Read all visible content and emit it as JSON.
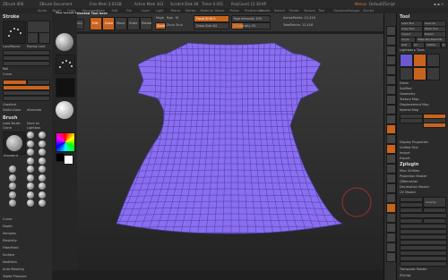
{
  "titlebar": {
    "app": "ZBrush 4R6",
    "doc": "ZBrush Document",
    "free_mem": "Free Mem 3.01GB",
    "active_mem": "Active Mem 342",
    "scratch": "Scratch Disk 48",
    "timer": "Timer 0.001",
    "poly_count": "PolyCount 12.39 KP",
    "menus": "Menus",
    "default_script": "DefaultZScript"
  },
  "menubar": {
    "items": [
      "Alpha",
      "Brush",
      "Color",
      "Document",
      "Draw",
      "Edit",
      "File",
      "Layer",
      "Light",
      "Macro",
      "Marker",
      "Material",
      "Movie",
      "Picker",
      "Preferences",
      "Render",
      "Stencil",
      "Stroke",
      "Texture",
      "Tool",
      "Transform",
      "Zplugin",
      "Zscript"
    ]
  },
  "topbar": {
    "hint": "The Insert Selected Tool here",
    "projection_master": "Projection Master",
    "lightbox": "LightBox",
    "edit": "Edit",
    "draw": "Draw",
    "move": "Move",
    "scale": "Scale",
    "rotate": "Rotate",
    "mrgb": "Mrgb",
    "rgb": "Rgb",
    "m": "M",
    "zadd": "Zadd",
    "zsub": "Zsub",
    "zcut": "Zcut",
    "focal_shift": "Focal Shift 0",
    "draw_size": "Draw Size 64",
    "rgb_intensity": "Rgb Intensity 100",
    "z_intensity": "Z Intensity 25",
    "active_points": "ActivePoints: 12,416",
    "total_points": "TotalPoints: 12,416"
  },
  "left": {
    "title": "Stroke",
    "lazy_mouse": "LazyMouse",
    "replay_last": "Replay Last",
    "roll": "Roll",
    "curve": "Curve",
    "brush_section": "Brush",
    "load_brush": "Load Brush",
    "save_as": "Save As",
    "clone": "Clone",
    "lightbox_brushes": "Lightbox",
    "standard": "Standard",
    "groups": [
      "Curve",
      "Depth",
      "Samples",
      "Elasticity",
      "FiberMesh",
      "Surface",
      "Modifiers",
      "Auto Masking",
      "Tablet Pressure",
      "Alpha and Texture",
      "Clip Brush Modifiers",
      "Smooth Brush Modifiers",
      "Edit Brush Credit",
      "Reset All Brushes"
    ],
    "gradient": "Gradient",
    "switch_color": "SwitchColor",
    "alternate": "Alternate"
  },
  "right": {
    "title": "Tool",
    "load_tool": "Load Tool",
    "save_as": "Save As",
    "copy_tool": "Copy Tool",
    "paste_tool": "Paste Tool",
    "import": "Import",
    "export": "Export",
    "clone": "Clone",
    "make_polymesh": "Make PolyMesh3D",
    "goz": "GoZ",
    "all": "All",
    "visible": "Visible",
    "r": "R",
    "lightbox_tools": "Lightbox ▸ Tools",
    "current_tool": "Dress",
    "subtool": "SubTool",
    "geometry": "Geometry",
    "texture_map": "Texture Map",
    "displacement_map": "Displacement Map",
    "normal_map": "Normal Map",
    "display_properties": "Display Properties",
    "unified_skin": "Unified Skin",
    "import_section": "Import",
    "export_section": "Export",
    "zplugin": "Zplugin",
    "misc_utilities": "Misc Utilities",
    "projection_master": "Projection Master",
    "qremesher": "QRemesher",
    "decimation": "Decimation Master",
    "uv_master": "UV Master",
    "unwrap": "Unwrap",
    "transpose_master": "Transpose Master",
    "zscript": "ZScript"
  },
  "colors": {
    "mesh_fill": "#8a6ef0",
    "mesh_line": "#4b3aa0",
    "accent": "#c9641e",
    "panel": "#2b2b2b"
  }
}
